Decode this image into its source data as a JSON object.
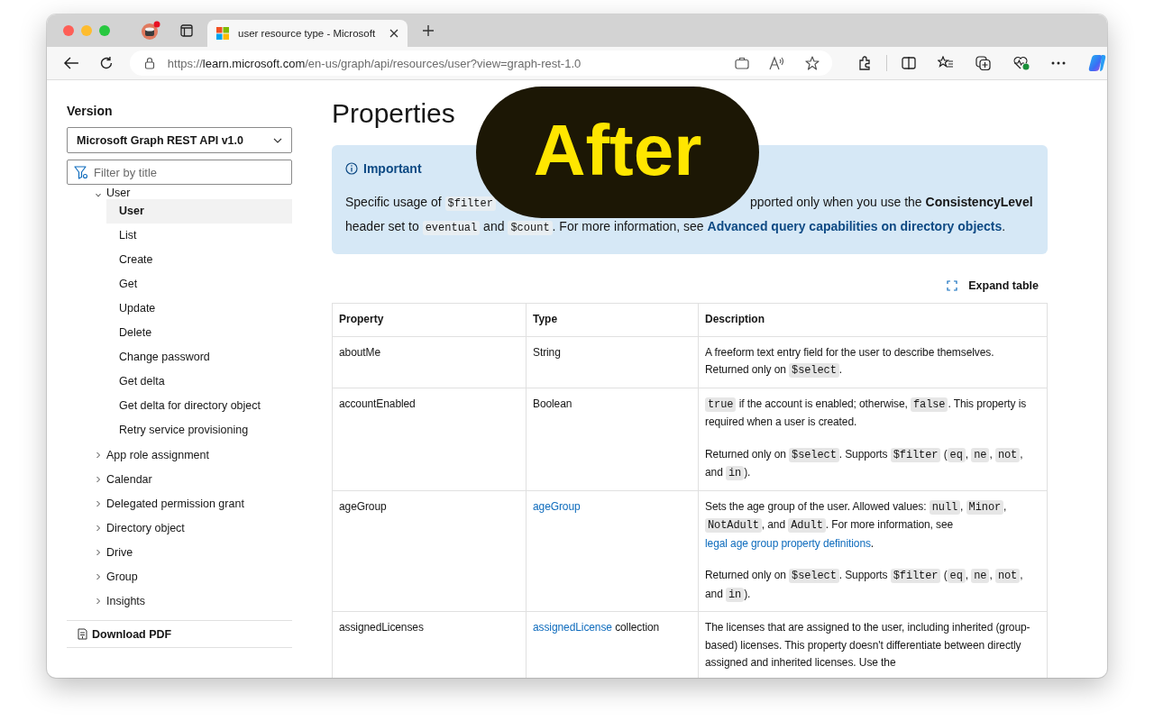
{
  "browser": {
    "tab_title": "user resource type - Microsoft",
    "url": {
      "scheme": "https://",
      "host": "learn.microsoft.com",
      "path": "/en-us/graph/api/resources/user?view=graph-rest-1.0"
    }
  },
  "sidebar": {
    "version_label": "Version",
    "version_value": "Microsoft Graph REST API v1.0",
    "filter": {
      "placeholder": "Filter by title"
    },
    "tree": [
      {
        "label": "User",
        "expanded": true,
        "children": [
          {
            "label": "User",
            "selected": true
          },
          {
            "label": "List",
            "selected": false
          },
          {
            "label": "Create",
            "selected": false
          },
          {
            "label": "Get",
            "selected": false
          },
          {
            "label": "Update",
            "selected": false
          },
          {
            "label": "Delete",
            "selected": false
          },
          {
            "label": "Change password",
            "selected": false
          },
          {
            "label": "Get delta",
            "selected": false
          },
          {
            "label": "Get delta for directory object",
            "selected": false
          },
          {
            "label": "Retry service provisioning",
            "selected": false
          }
        ]
      },
      {
        "label": "App role assignment",
        "expanded": false
      },
      {
        "label": "Calendar",
        "expanded": false
      },
      {
        "label": "Delegated permission grant",
        "expanded": false
      },
      {
        "label": "Directory object",
        "expanded": false
      },
      {
        "label": "Drive",
        "expanded": false
      },
      {
        "label": "Group",
        "expanded": false
      },
      {
        "label": "Insights",
        "expanded": false
      }
    ],
    "download": "Download PDF"
  },
  "main": {
    "title": "Properties",
    "callout": {
      "heading": "Important",
      "line_1a": [
        {
          "kind": "text",
          "text": "Specific usage of "
        },
        {
          "kind": "code",
          "text": "$filter"
        }
      ],
      "line_1b": [
        {
          "kind": "text",
          "text": "pported only when you use the "
        },
        {
          "kind": "bold",
          "text": "ConsistencyLevel"
        }
      ],
      "line_2": [
        {
          "kind": "text",
          "text": "header set to "
        },
        {
          "kind": "code",
          "text": "eventual"
        },
        {
          "kind": "text",
          "text": " and "
        },
        {
          "kind": "code",
          "text": "$count"
        },
        {
          "kind": "text",
          "text": ". For more information, see "
        },
        {
          "kind": "link",
          "text": "Advanced query capabilities on directory objects"
        },
        {
          "kind": "text",
          "text": "."
        }
      ]
    },
    "expand_table": "Expand table",
    "table": {
      "columns": [
        "Property",
        "Type",
        "Description"
      ],
      "rows": [
        {
          "property": "aboutMe",
          "type": [
            {
              "kind": "text",
              "text": "String"
            }
          ],
          "description": [
            [
              {
                "kind": "text",
                "text": "A freeform text entry field for the user to describe themselves. Returned only on "
              },
              {
                "kind": "code",
                "text": "$select"
              },
              {
                "kind": "text",
                "text": "."
              }
            ]
          ]
        },
        {
          "property": "accountEnabled",
          "type": [
            {
              "kind": "text",
              "text": "Boolean"
            }
          ],
          "description": [
            [
              {
                "kind": "code",
                "text": "true"
              },
              {
                "kind": "text",
                "text": " if the account is enabled; otherwise, "
              },
              {
                "kind": "code",
                "text": "false"
              },
              {
                "kind": "text",
                "text": ". This property is required when a user is created."
              }
            ],
            [
              {
                "kind": "text",
                "text": "Returned only on "
              },
              {
                "kind": "code",
                "text": "$select"
              },
              {
                "kind": "text",
                "text": ". Supports "
              },
              {
                "kind": "code",
                "text": "$filter"
              },
              {
                "kind": "text",
                "text": " ("
              },
              {
                "kind": "code",
                "text": "eq"
              },
              {
                "kind": "text",
                "text": ", "
              },
              {
                "kind": "code",
                "text": "ne"
              },
              {
                "kind": "text",
                "text": ", "
              },
              {
                "kind": "code",
                "text": "not"
              },
              {
                "kind": "text",
                "text": ", and "
              },
              {
                "kind": "code",
                "text": "in"
              },
              {
                "kind": "text",
                "text": ")."
              }
            ]
          ]
        },
        {
          "property": "ageGroup",
          "type": [
            {
              "kind": "link",
              "text": "ageGroup"
            }
          ],
          "description": [
            [
              {
                "kind": "text",
                "text": "Sets the age group of the user. Allowed values: "
              },
              {
                "kind": "code",
                "text": "null"
              },
              {
                "kind": "text",
                "text": ", "
              },
              {
                "kind": "code",
                "text": "Minor"
              },
              {
                "kind": "text",
                "text": ", "
              },
              {
                "kind": "code",
                "text": "NotAdult"
              },
              {
                "kind": "text",
                "text": ", and "
              },
              {
                "kind": "code",
                "text": "Adult"
              },
              {
                "kind": "text",
                "text": ". For more information, see "
              },
              {
                "kind": "link",
                "text": "legal age group property definitions"
              },
              {
                "kind": "text",
                "text": "."
              }
            ],
            [
              {
                "kind": "text",
                "text": "Returned only on "
              },
              {
                "kind": "code",
                "text": "$select"
              },
              {
                "kind": "text",
                "text": ". Supports "
              },
              {
                "kind": "code",
                "text": "$filter"
              },
              {
                "kind": "text",
                "text": " ("
              },
              {
                "kind": "code",
                "text": "eq"
              },
              {
                "kind": "text",
                "text": ", "
              },
              {
                "kind": "code",
                "text": "ne"
              },
              {
                "kind": "text",
                "text": ", "
              },
              {
                "kind": "code",
                "text": "not"
              },
              {
                "kind": "text",
                "text": ", and "
              },
              {
                "kind": "code",
                "text": "in"
              },
              {
                "kind": "text",
                "text": ")."
              }
            ]
          ]
        },
        {
          "property": "assignedLicenses",
          "type": [
            {
              "kind": "link",
              "text": "assignedLicense"
            },
            {
              "kind": "text",
              "text": " collection"
            }
          ],
          "description": [
            [
              {
                "kind": "text",
                "text": "The licenses that are assigned to the user, including inherited (group-based) licenses. This property doesn't differentiate between directly assigned and inherited licenses. Use the"
              }
            ]
          ]
        }
      ]
    }
  },
  "overlay_badge": "After"
}
